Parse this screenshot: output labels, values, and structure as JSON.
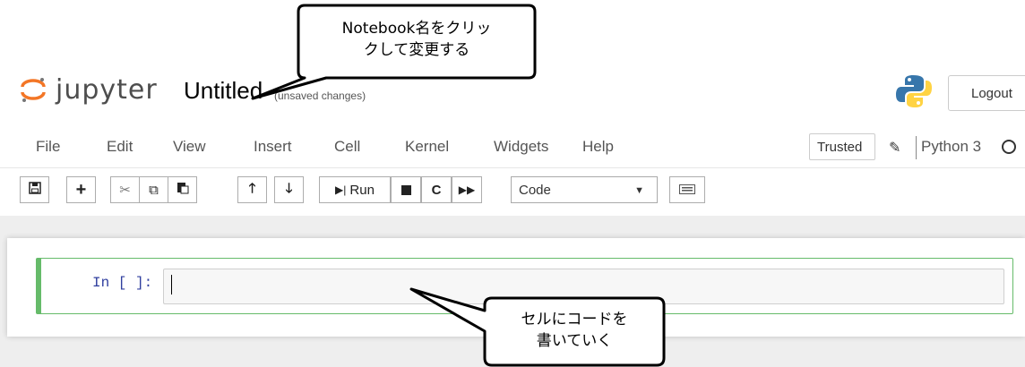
{
  "header": {
    "logo_text": "jupyter",
    "notebook_name": "Untitled",
    "save_status": "(unsaved changes)",
    "logout_label": "Logout"
  },
  "menubar": {
    "items": [
      "File",
      "Edit",
      "View",
      "Insert",
      "Cell",
      "Kernel",
      "Widgets",
      "Help"
    ],
    "trusted_label": "Trusted",
    "kernel_name": "Python 3"
  },
  "toolbar": {
    "run_label": "Run",
    "cell_type": "Code",
    "icons": [
      "save-icon",
      "add-icon",
      "cut-icon",
      "copy-icon",
      "paste-icon",
      "move-up-icon",
      "move-down-icon",
      "run-icon",
      "stop-icon",
      "restart-icon",
      "fast-forward-icon",
      "keyboard-icon"
    ]
  },
  "cell": {
    "prompt": "In [ ]:",
    "content": ""
  },
  "annotations": {
    "rename_callout": [
      "Notebook名をクリッ",
      "クして変更する"
    ],
    "cell_callout": [
      "セルにコードを",
      "書いていく"
    ]
  },
  "colors": {
    "jupyter_orange": "#f37626",
    "cell_border": "#66bb6a",
    "prompt_blue": "#303f9f"
  }
}
